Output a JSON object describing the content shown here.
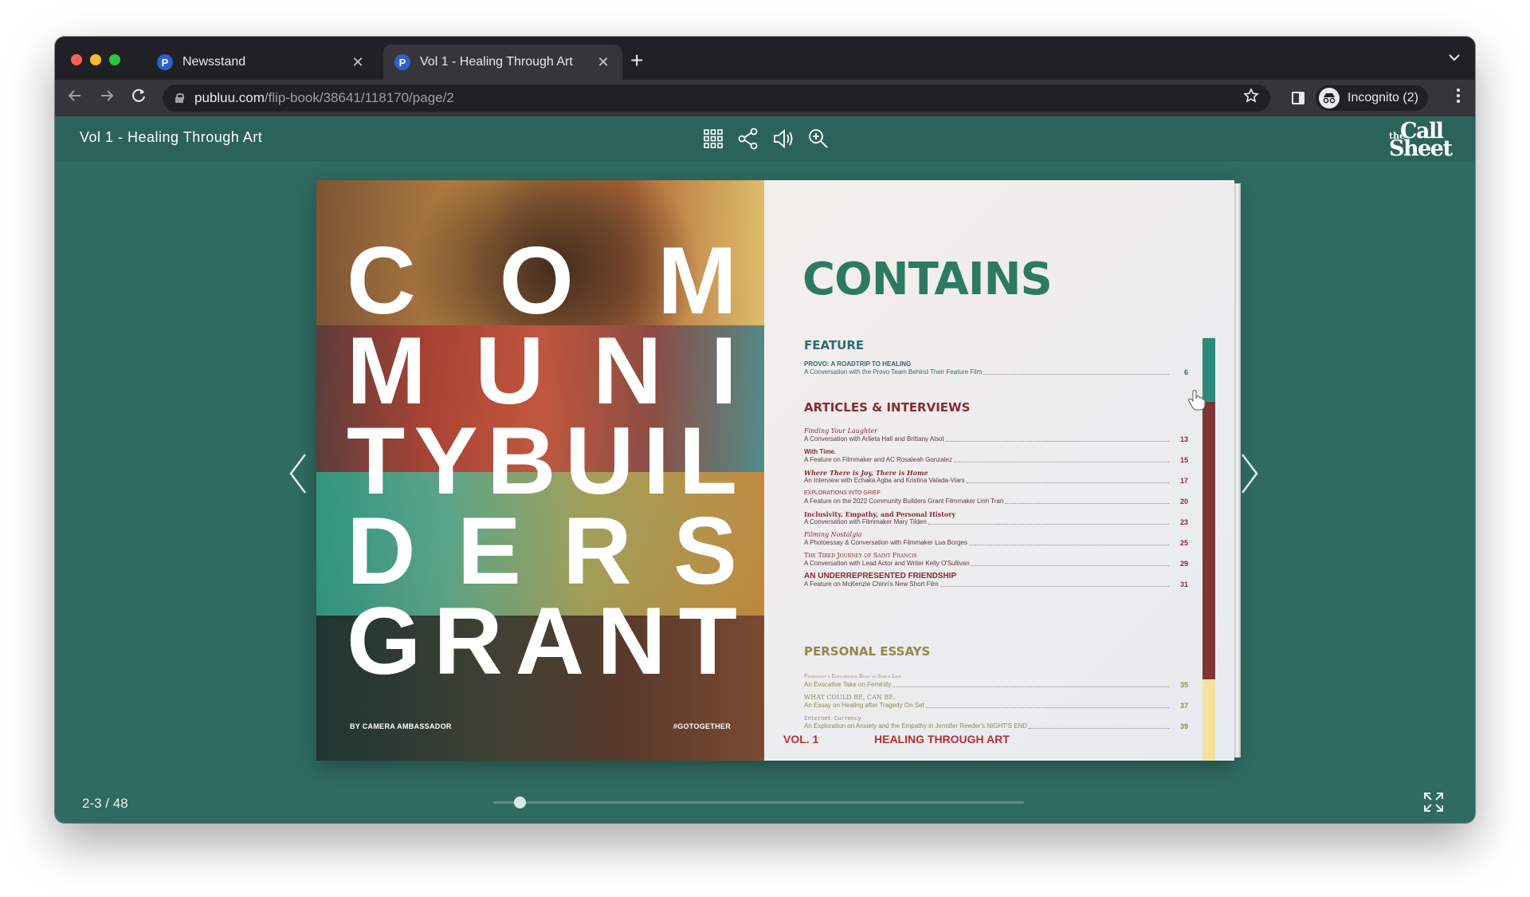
{
  "browser": {
    "tabs": [
      {
        "label": "Newsstand",
        "favicon": "P"
      },
      {
        "label": "Vol 1 - Healing Through Art",
        "favicon": "P"
      }
    ],
    "close_glyph": "✕",
    "new_tab_glyph": "+",
    "url_host": "publuu.com",
    "url_path": "/flip-book/38641/118170/page/2",
    "incognito_label": "Incognito (2)"
  },
  "flipbook": {
    "title": "Vol 1 - Healing Through Art",
    "logo_the": "the",
    "logo_call": "Call",
    "logo_sheet": "Sheet",
    "page_indicator": "2-3 / 48",
    "slider_position": 0.05
  },
  "left_page": {
    "rows": [
      [
        "C",
        "O",
        "M"
      ],
      [
        "M",
        "U",
        "N",
        "I"
      ],
      [
        "T",
        "Y",
        "B",
        "U",
        "I",
        "L"
      ],
      [
        "D",
        "E",
        "R",
        "S"
      ],
      [
        "G",
        "R",
        "A",
        "N",
        "T"
      ]
    ],
    "byline": "BY CAMERA AMBASSADOR",
    "hashtag": "#GOTOGETHER"
  },
  "right_page": {
    "title": "CONTAINS",
    "sections": {
      "feature": "FEATURE",
      "articles": "ARTICLES & INTERVIEWS",
      "essays": "PERSONAL ESSAYS"
    },
    "feature_entries": [
      {
        "head": "PROVO: A ROADTRIP TO HEALING",
        "sub": "A Conversation with the Provo Team Behind Their Feature Film",
        "page": "6"
      }
    ],
    "article_entries": [
      {
        "head": "Finding Your Laughter",
        "sub": "A Conversation with Arlieta Hall and Brittany Alsot",
        "page": "13"
      },
      {
        "head": "With Time.",
        "sub": "A Feature on Filmmaker and AC Rosaleah Gonzalez",
        "page": "15"
      },
      {
        "head": "Where There is Joy, There is Home",
        "sub": "An Interview with Echaka Agba and Kristina Valada-Viars",
        "page": "17"
      },
      {
        "head": "EXPLORATIONS INTO GRIEF",
        "sub": "A Feature on the 2022 Community Builders Grant Filmmaker Linh Tran",
        "page": "20"
      },
      {
        "head": "Inclusivity, Empathy, and Personal History",
        "sub": "A Conversation with Filmmaker Mary Tilden",
        "page": "23"
      },
      {
        "head": "Filming Nostalgia",
        "sub": "A Photoessay & Conversation with Filmmaker Lua Borges",
        "page": "25"
      },
      {
        "head": "The Tired Journey of Saint Francis",
        "sub": "A Conversation with Lead Actor and Writer Kelly O'Sullivan",
        "page": "29"
      },
      {
        "head": "AN UNDERREPRESENTED FRIENDSHIP",
        "sub": "A Feature on McKenzie Chinn's New Short Film",
        "page": "31"
      }
    ],
    "essay_entries": [
      {
        "head": "Femininity's Exploration Built in Shelf Life",
        "sub": "An Evocative Take on Feminity",
        "page": "35"
      },
      {
        "head": "WHAT COULD BE, CAN BE.",
        "sub": "An Essay on Healing after Tragedy On Set",
        "page": "37"
      },
      {
        "head": "Internet Currency",
        "sub": "An Exploration on Anxiety and the Empathy in Jennifer Reeder's NIGHT'S END",
        "page": "39"
      }
    ],
    "footer_vol": "VOL. 1",
    "footer_theme": "HEALING THROUGH ART"
  },
  "colors": {
    "viewer_bg": "#2f6b61",
    "viewer_header": "#2b635a",
    "contents_title": "#2d7a63",
    "accent_red": "#b5312d"
  }
}
